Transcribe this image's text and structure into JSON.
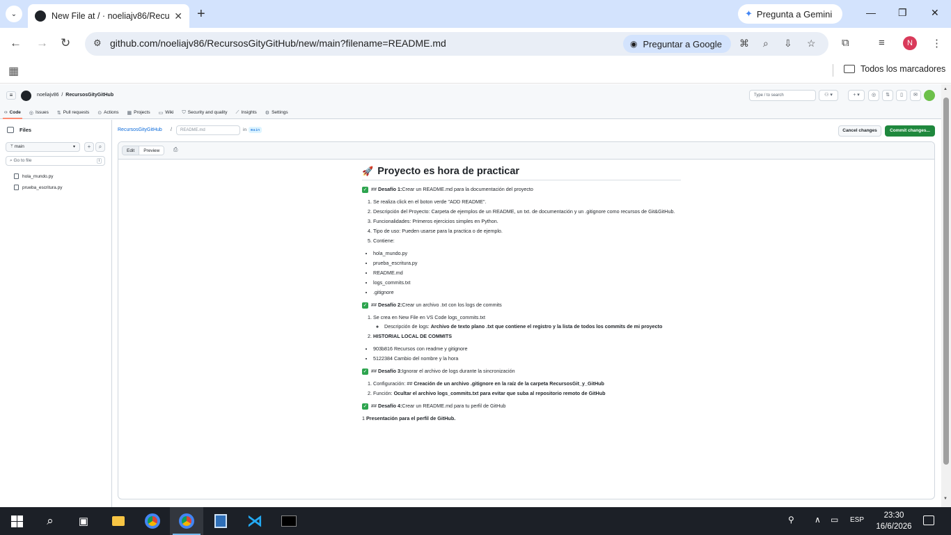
{
  "browser": {
    "tab_title": "New File at / · noeliajv86/RecursosGityGitHub",
    "gemini_label": "Pregunta a Gemini",
    "url": "github.com/noeliajv86/RecursosGityGitHub/new/main?filename=README.md",
    "ask_google_label": "Preguntar a Google",
    "profile_initial": "N",
    "bookmarks_all": "Todos los marcadores"
  },
  "github": {
    "owner": "noeliajv86",
    "repo": "RecursosGityGitHub",
    "search_placeholder": "Type / to search",
    "repo_nav": [
      {
        "label": "Code",
        "icon": "code-icon"
      },
      {
        "label": "Issues",
        "icon": "issue-icon"
      },
      {
        "label": "Pull requests",
        "icon": "pull-request-icon"
      },
      {
        "label": "Actions",
        "icon": "play-icon"
      },
      {
        "label": "Projects",
        "icon": "table-icon"
      },
      {
        "label": "Wiki",
        "icon": "book-icon"
      },
      {
        "label": "Security and quality",
        "icon": "shield-icon"
      },
      {
        "label": "Insights",
        "icon": "graph-icon"
      },
      {
        "label": "Settings",
        "icon": "gear-icon"
      }
    ]
  },
  "filetree": {
    "title": "Files",
    "branch": "main",
    "goto_placeholder": "Go to file",
    "goto_shortcut": "t",
    "files": [
      "hola_mundo.py",
      "prueba_escritura.py"
    ]
  },
  "editor": {
    "repo_link": "RecursosGityGitHub",
    "separator": "/",
    "filename_value": "README.md",
    "in_label": "in",
    "branch": "main",
    "cancel_label": "Cancel changes",
    "commit_label": "Commit changes...",
    "tab_edit": "Edit",
    "tab_preview": "Preview"
  },
  "preview": {
    "title": "Proyecto es hora de practicar",
    "d1_prefix": "## ",
    "d1_label": "Desafío 1:",
    "d1_text": " Crear un README.md para la documentación del proyecto",
    "d1_steps": [
      "Se realiza click en el boton verde \"ADD README\".",
      "Descripción del Proyecto: Carpeta de ejemplos de un README, un txt. de documentación y un .gitignore como recursos de Git&GitHub.",
      "Funcionalidades: Primeros ejercicios simples en Python.",
      "Tipo de uso: Pueden usarse para la practica o de ejemplo.",
      "Contiene:"
    ],
    "d1_files": [
      "hola_mundo.py",
      "prueba_escritura.py",
      "README.md",
      "logs_commits.txt",
      ".gitignore"
    ],
    "d2_prefix": "## ",
    "d2_label": "Desafío 2:",
    "d2_text": " Crear un archivo .txt con los logs de commits",
    "d2_step1": "Se crea en New File en VS Code logs_commits.txt",
    "d2_sub_label": "Descripción de logs: ",
    "d2_sub_bold": "Archivo de texto plano .txt que contiene el registro y la lista de todos los commits de mi proyecto",
    "d2_step2": "HISTORIAL LOCAL DE COMMITS",
    "commits": [
      "903b816 Recursos con readme y gitignore",
      "5122384 Cambio del nombre y la hora"
    ],
    "d3_prefix": "## ",
    "d3_label": "Desafío 3:",
    "d3_text": " Ignorar el archivo de logs durante la sincronización",
    "d3_s1_label": "Configuración: ## ",
    "d3_s1_bold": "Creación de un archivo .gitignore en la raíz de la carpeta RecursosGit_y_GitHub",
    "d3_s2_label": "Función: ",
    "d3_s2_bold": "Ocultar el archivo logs_commits.txt para evitar que suba al repositorio remoto de GitHub",
    "d4_prefix": "## ",
    "d4_label": "Desafío 4:",
    "d4_text": " Crear un README.md para tu perfil de GitHub",
    "last_num": "1 ",
    "last_bold": "Presentación para el perfil de GitHub."
  },
  "taskbar": {
    "lang": "ESP",
    "time": "23:30",
    "date": "16/6/2026"
  }
}
